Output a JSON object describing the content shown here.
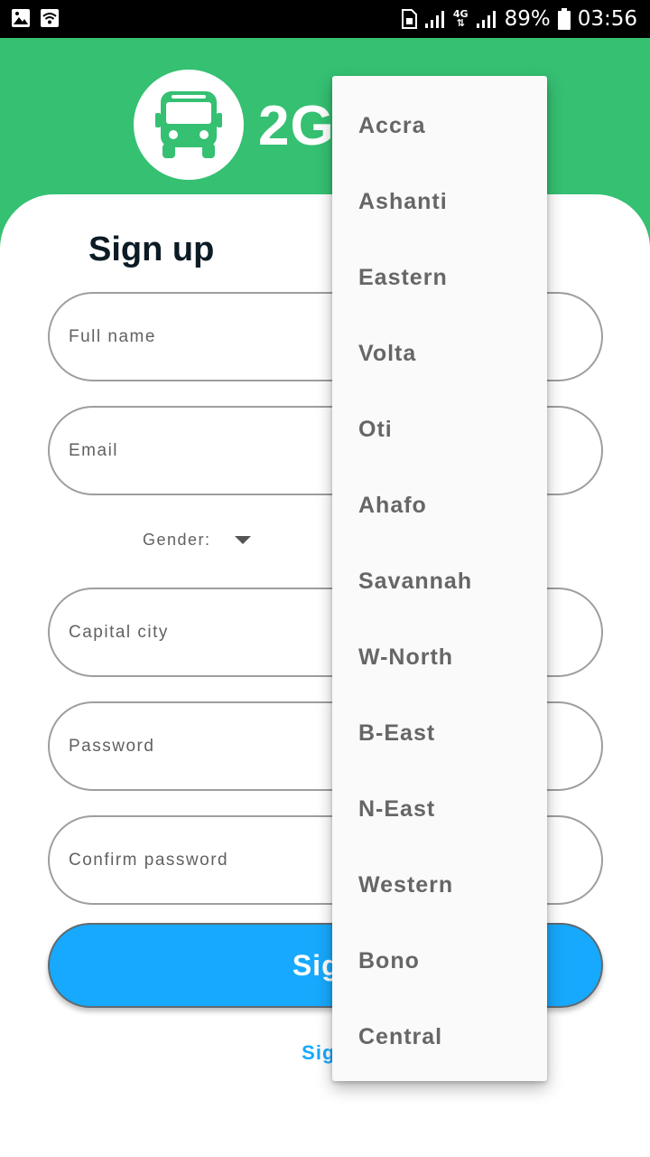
{
  "status_bar": {
    "battery": "89%",
    "time": "03:56",
    "network": "4G",
    "icons": [
      "image-icon",
      "wifi-icon",
      "sim-icon",
      "signal-icon",
      "battery-icon"
    ]
  },
  "header": {
    "title": "2G",
    "logo_icon": "bus-icon",
    "background_color": "#35c072"
  },
  "form": {
    "heading": "Sign up",
    "full_name_placeholder": "Full name",
    "email_placeholder": "Email",
    "gender_label": "Gender:",
    "capital_city_placeholder": "Capital city",
    "password_placeholder": "Password",
    "confirm_password_placeholder": "Confirm password",
    "submit_label": "Sign",
    "signin_link": "Sign",
    "accent_color": "#17a9fd"
  },
  "dropdown": {
    "items": [
      "Accra",
      "Ashanti",
      "Eastern",
      "Volta",
      "Oti",
      "Ahafo",
      "Savannah",
      "W-North",
      "B-East",
      "N-East",
      "Western",
      "Bono",
      "Central"
    ]
  }
}
